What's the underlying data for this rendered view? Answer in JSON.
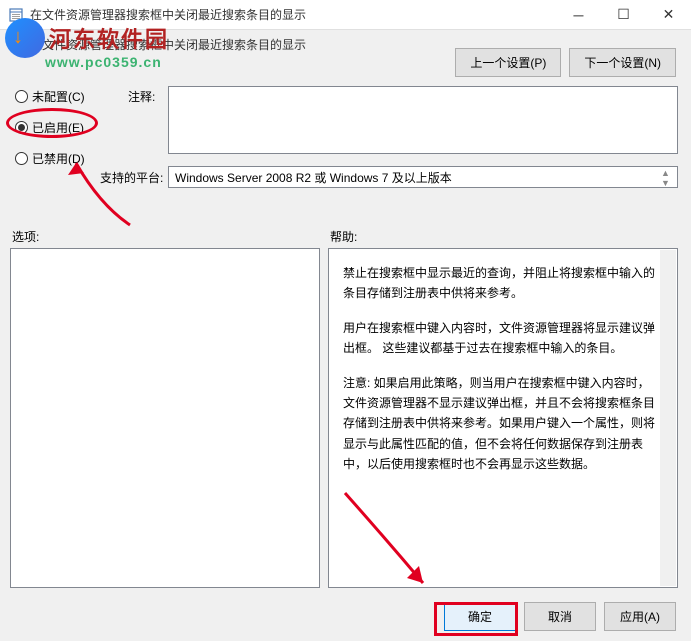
{
  "titlebar": {
    "title": "在文件资源管理器搜索框中关闭最近搜索条目的显示"
  },
  "subtitle": "在文件资源管理器搜索框中关闭最近搜索条目的显示",
  "watermark": {
    "brand": "河东软件园",
    "url": "www.pc0359.cn"
  },
  "nav": {
    "prev": "上一个设置(P)",
    "next": "下一个设置(N)"
  },
  "radios": {
    "unconfigured": "未配置(C)",
    "enabled": "已启用(E)",
    "disabled": "已禁用(D)"
  },
  "labels": {
    "comment": "注释:",
    "platforms": "支持的平台:",
    "options": "选项:",
    "help": "帮助:"
  },
  "platforms_text": "Windows Server 2008 R2 或 Windows 7 及以上版本",
  "help_text": {
    "p1": "禁止在搜索框中显示最近的查询，并阻止将搜索框中输入的条目存储到注册表中供将来参考。",
    "p2": "用户在搜索框中键入内容时，文件资源管理器将显示建议弹出框。 这些建议都基于过去在搜索框中输入的条目。",
    "p3": "注意: 如果启用此策略，则当用户在搜索框中键入内容时，文件资源管理器不显示建议弹出框，并且不会将搜索框条目存储到注册表中供将来参考。如果用户键入一个属性，则将显示与此属性匹配的值，但不会将任何数据保存到注册表中，以后使用搜索框时也不会再显示这些数据。"
  },
  "buttons": {
    "ok": "确定",
    "cancel": "取消",
    "apply": "应用(A)"
  }
}
